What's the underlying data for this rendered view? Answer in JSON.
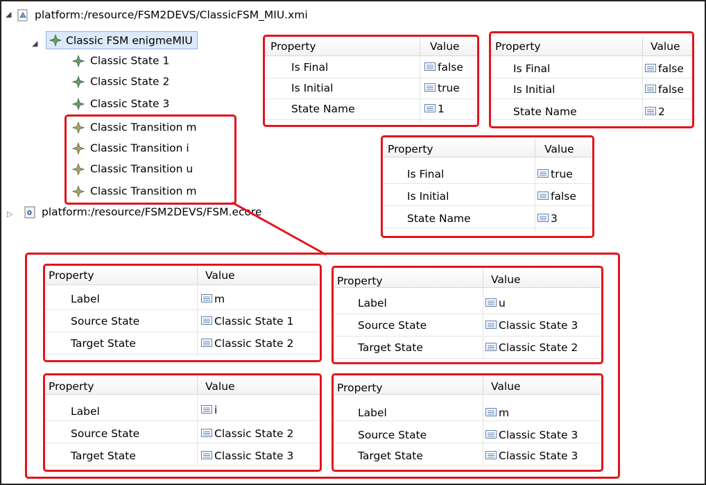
{
  "tree": {
    "root_file": "platform:/resource/FSM2DEVS/ClassicFSM_MIU.xmi",
    "fsm": "Classic FSM enigmeMIU",
    "states": [
      "Classic State 1",
      "Classic State 2",
      "Classic State 3"
    ],
    "transitions": [
      "Classic Transition m",
      "Classic Transition i",
      "Classic Transition u",
      "Classic Transition m"
    ],
    "ecore_file": "platform:/resource/FSM2DEVS/FSM.ecore"
  },
  "headers": {
    "property": "Property",
    "value": "Value"
  },
  "state_props": [
    {
      "rows": [
        {
          "p": "Is Final",
          "v": "false"
        },
        {
          "p": "Is Initial",
          "v": "true"
        },
        {
          "p": "State Name",
          "v": "1"
        }
      ]
    },
    {
      "rows": [
        {
          "p": "Is Final",
          "v": "false"
        },
        {
          "p": "Is Initial",
          "v": "false"
        },
        {
          "p": "State Name",
          "v": "2"
        }
      ]
    },
    {
      "rows": [
        {
          "p": "Is Final",
          "v": "true"
        },
        {
          "p": "Is Initial",
          "v": "false"
        },
        {
          "p": "State Name",
          "v": "3"
        }
      ]
    }
  ],
  "transition_props": [
    {
      "rows": [
        {
          "p": "Label",
          "v": "m"
        },
        {
          "p": "Source State",
          "v": "Classic State 1"
        },
        {
          "p": "Target State",
          "v": "Classic State 2"
        }
      ]
    },
    {
      "rows": [
        {
          "p": "Label",
          "v": "u"
        },
        {
          "p": "Source State",
          "v": "Classic State 3"
        },
        {
          "p": "Target State",
          "v": "Classic State 2"
        }
      ]
    },
    {
      "rows": [
        {
          "p": "Label",
          "v": "i"
        },
        {
          "p": "Source State",
          "v": "Classic State 2"
        },
        {
          "p": "Target State",
          "v": "Classic State 3"
        }
      ]
    },
    {
      "rows": [
        {
          "p": "Label",
          "v": "m"
        },
        {
          "p": "Source State",
          "v": "Classic State 3"
        },
        {
          "p": "Target State",
          "v": "Classic State 3"
        }
      ]
    }
  ],
  "colors": {
    "highlight": "#e2141b",
    "selection": "#dbe9fb",
    "node_icon": "#5e8a5e"
  }
}
